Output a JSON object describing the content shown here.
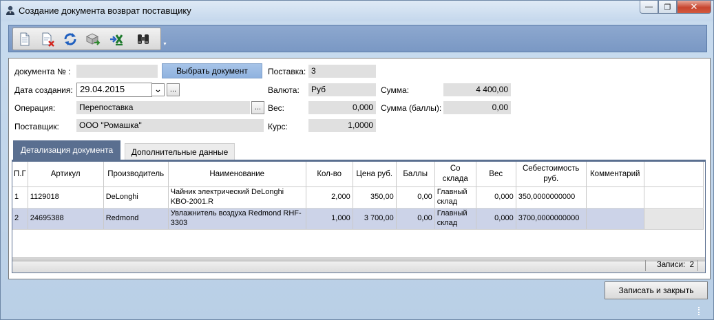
{
  "window": {
    "title": "Создание документа возврат поставщику",
    "min_glyph": "—",
    "max_glyph": "❐",
    "close_glyph": "✕"
  },
  "toolbar": {
    "icons": [
      "new-document-icon",
      "delete-document-icon",
      "refresh-icon",
      "export-icon",
      "excel-export-icon",
      "binoculars-icon"
    ],
    "grip_glyph": "▾"
  },
  "form": {
    "doc_number_label": "документа № :",
    "doc_number_value": "",
    "select_doc_label": "Выбрать документ",
    "date_label": "Дата создания:",
    "date_value": "29.04.2015",
    "date_dropdown_glyph": "⌄",
    "ellipsis": "...",
    "operation_label": "Операция:",
    "operation_value": "Перепоставка",
    "supplier_label": "Поставщик:",
    "supplier_value": "ООО \"Ромашка\"",
    "delivery_label": "Поставка:",
    "delivery_value": "3",
    "currency_label": "Валюта:",
    "currency_value": "Руб",
    "weight_label": "Вес:",
    "weight_value": "0,000",
    "rate_label": "Курс:",
    "rate_value": "1,0000",
    "sum_label": "Сумма:",
    "sum_value": "4 400,00",
    "sum_points_label": "Сумма (баллы):",
    "sum_points_value": "0,00"
  },
  "tabs": [
    {
      "label": "Детализация документа",
      "active": true
    },
    {
      "label": "Дополнительные данные",
      "active": false
    }
  ],
  "grid": {
    "columns": [
      "П.Г",
      "Артикул",
      "Производитель",
      "Наименование",
      "Кол-во",
      "Цена руб.",
      "Баллы",
      "Со склада",
      "Вес",
      "Себестоимость руб.",
      "Комментарий",
      ""
    ],
    "rows": [
      [
        "1",
        "1129018",
        "DeLonghi",
        "Чайник электрический DeLonghi KBO-2001.R",
        "2,000",
        "350,00",
        "0,00",
        "Главный склад",
        "0,000",
        "350,0000000000",
        "",
        ""
      ],
      [
        "2",
        "24695388",
        "Redmond",
        "Увлажнитель воздуха Redmond RHF-3303",
        "1,000",
        "3 700,00",
        "0,00",
        "Главный склад",
        "0,000",
        "3700,0000000000",
        "",
        ""
      ]
    ],
    "records_label": "Записи:",
    "records_count": "2"
  },
  "footer": {
    "save_close_label": "Записать и закрыть"
  },
  "colors": {
    "toolbar_bg": "#7a98c4",
    "tab_active": "#5a6f90",
    "select_button": "#9bbbe4",
    "selected_row": "#ccd3e8"
  }
}
